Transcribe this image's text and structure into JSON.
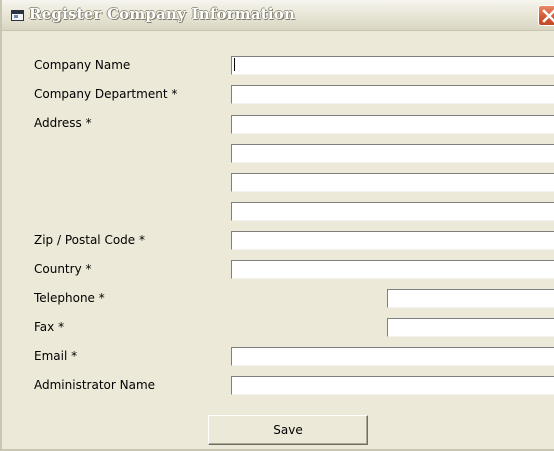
{
  "window": {
    "title": "Register Company Information"
  },
  "form": {
    "company_name": {
      "label": "Company Name",
      "value": ""
    },
    "company_department": {
      "label": "Company Department *",
      "value": ""
    },
    "address": {
      "label": "Address *",
      "line1": "",
      "line2": "",
      "line3": "",
      "line4": ""
    },
    "zip": {
      "label": "Zip / Postal Code *",
      "value": ""
    },
    "country": {
      "label": "Country *",
      "value": ""
    },
    "telephone": {
      "label": "Telephone *",
      "value": ""
    },
    "fax": {
      "label": "Fax *",
      "value": ""
    },
    "email": {
      "label": "Email *",
      "value": ""
    },
    "administrator_name": {
      "label": "Administrator Name",
      "value": ""
    }
  },
  "save_label": "Save",
  "icons": {
    "window": "window-app-icon",
    "close": "close-icon"
  }
}
